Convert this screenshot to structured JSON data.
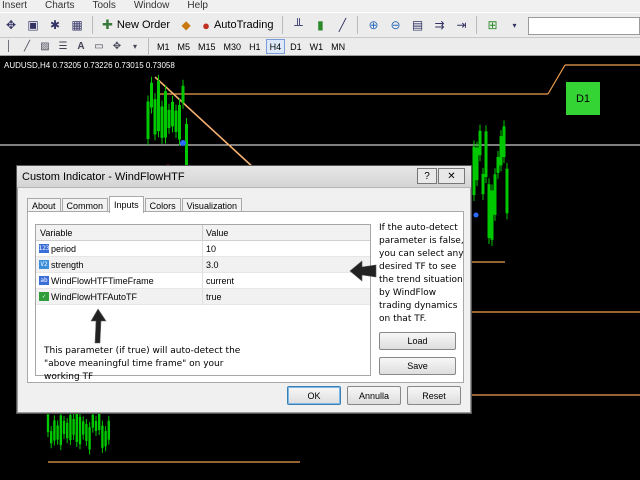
{
  "menu": [
    "Insert",
    "Charts",
    "Tools",
    "Window",
    "Help"
  ],
  "toolbar": {
    "new_order": "New Order",
    "auto_trading": "AutoTrading"
  },
  "timeframes": [
    {
      "label": "M1",
      "active": false
    },
    {
      "label": "M5",
      "active": false
    },
    {
      "label": "M15",
      "active": false
    },
    {
      "label": "M30",
      "active": false
    },
    {
      "label": "H1",
      "active": false
    },
    {
      "label": "H4",
      "active": true
    },
    {
      "label": "D1",
      "active": false
    },
    {
      "label": "W1",
      "active": false
    },
    {
      "label": "MN",
      "active": false
    }
  ],
  "chart": {
    "title": "AUDUSD,H4  0.73205 0.73226 0.73015 0.73058",
    "badge": "D1",
    "colors": {
      "candles": "#00c800",
      "hline": "#f0a050",
      "diag": "#f4b070",
      "hline_white": "#ffffff"
    }
  },
  "dialog": {
    "title": "Custom Indicator - WindFlowHTF",
    "help": "?",
    "close": "✕",
    "tabs": [
      "About",
      "Common",
      "Inputs",
      "Colors",
      "Visualization"
    ],
    "active_tab": "Inputs",
    "table": {
      "headers": [
        "Variable",
        "Value"
      ],
      "rows": [
        {
          "type": "123",
          "variable": "period",
          "value": "10",
          "type_color": "#3b6fd8"
        },
        {
          "type": "V2",
          "variable": "strength",
          "value": "3.0",
          "type_color": "#3b8fd8"
        },
        {
          "type": "ab",
          "variable": "WindFlowHTFTimeFrame",
          "value": "current",
          "type_color": "#3b6fd8"
        },
        {
          "type": "✓",
          "variable": "WindFlowHTFAutoTF",
          "value": "true",
          "type_color": "#2f9e3a"
        }
      ]
    },
    "annotation": "This parameter (if true) will auto-detect the \"above meaningful time frame\" on your working TF",
    "side_note": "If the auto-detect parameter is false, you can select any desired TF to see the trend situation by WindFlow trading dynamics on that TF.",
    "load": "Load",
    "save": "Save",
    "ok": "OK",
    "cancel": "Annulla",
    "reset": "Reset"
  }
}
